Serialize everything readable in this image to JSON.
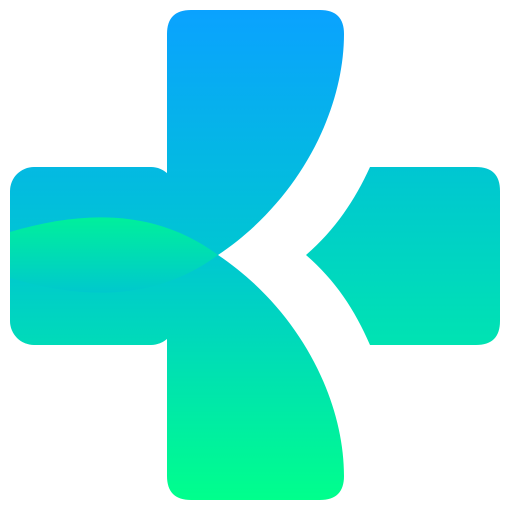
{
  "logo": {
    "icon": "medical-cross-logo-icon",
    "colors": {
      "background": "#ffffff",
      "gradient_top": "#0aa2ff",
      "gradient_mid": "#00c6d2",
      "gradient_bottom": "#00ff8c",
      "band_left": "#00e6a8",
      "band_right": "#00c2cf"
    }
  }
}
